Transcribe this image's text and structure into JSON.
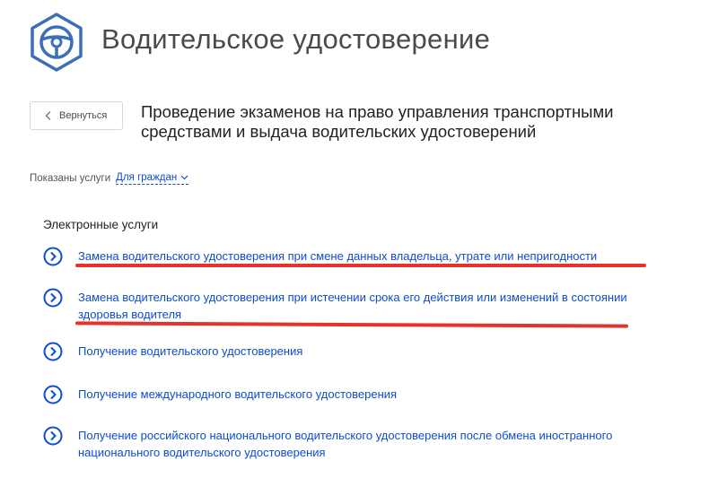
{
  "header": {
    "title": "Водительское удостоверение",
    "logo_icon": "steering-wheel-icon"
  },
  "toolbar": {
    "back_label": "Вернуться"
  },
  "service": {
    "title": "Проведение экзаменов на право управления транспортными средствами и выдача водительских удостоверений"
  },
  "filter": {
    "label": "Показаны услуги",
    "value": "Для граждан"
  },
  "section": {
    "heading": "Электронные услуги",
    "items": [
      {
        "label": "Замена водительского удостоверения при смене данных владельца, утрате или непригодности"
      },
      {
        "label": "Замена водительского удостоверения при истечении срока его действия или изменений в состоянии здоровья водителя"
      },
      {
        "label": "Получение водительского удостоверения"
      },
      {
        "label": "Получение международного водительского удостоверения"
      },
      {
        "label": "Получение российского национального водительского удостоверения после обмена иностранного национального водительского удостоверения"
      }
    ]
  },
  "colors": {
    "accent": "#0d4cd3",
    "logo": "#3b6fb6",
    "annotation": "#e8312a"
  }
}
